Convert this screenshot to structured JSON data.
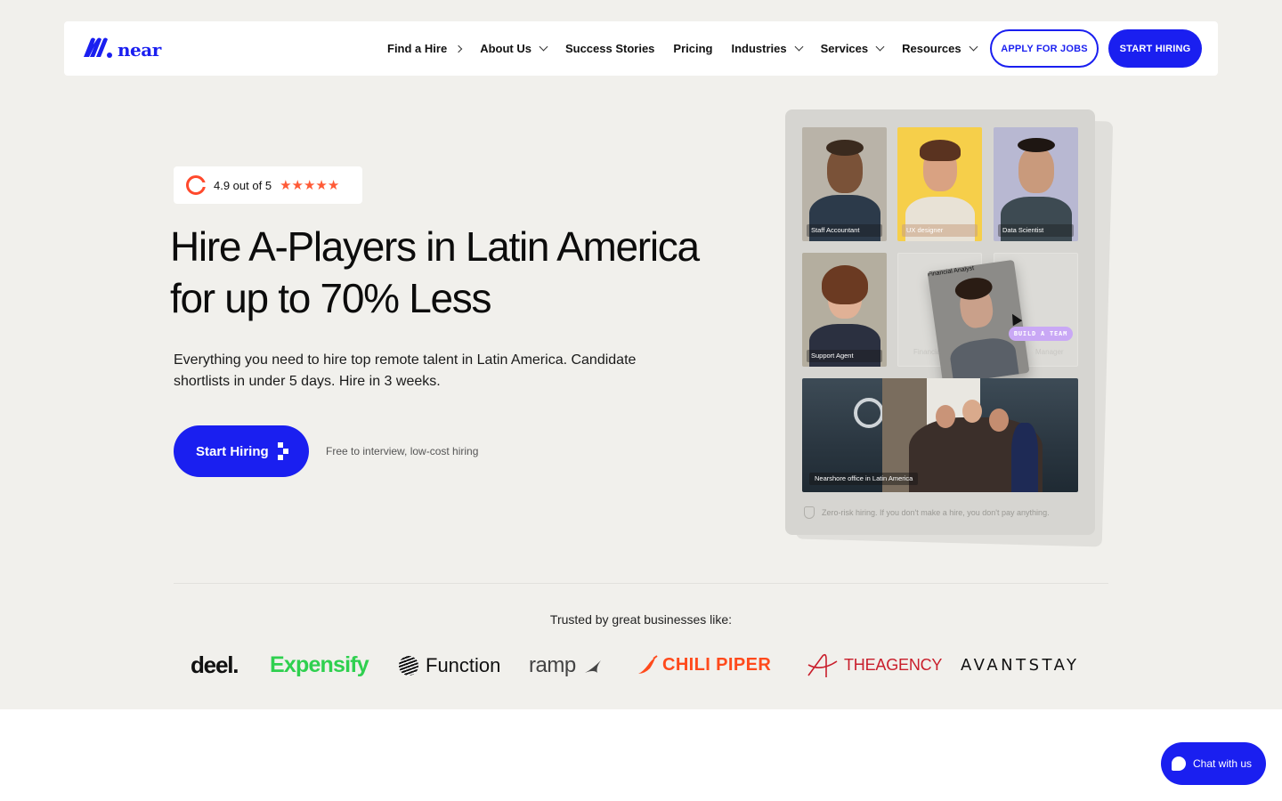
{
  "brand": {
    "name": "near",
    "accent": "#1a1ff0"
  },
  "nav": {
    "items": [
      {
        "label": "Find a Hire",
        "chevron": "right"
      },
      {
        "label": "About Us",
        "chevron": "down"
      },
      {
        "label": "Success Stories",
        "chevron": ""
      },
      {
        "label": "Pricing",
        "chevron": ""
      },
      {
        "label": "Industries",
        "chevron": "down"
      },
      {
        "label": "Services",
        "chevron": "down"
      },
      {
        "label": "Resources",
        "chevron": "down"
      }
    ],
    "apply_label": "APPLY FOR JOBS",
    "start_label": "START HIRING"
  },
  "rating": {
    "text": "4.9 out of 5",
    "stars": "★★★★★",
    "logo": "g2-icon"
  },
  "hero": {
    "headline_line1": "Hire A-Players in Latin America",
    "headline_line2": "for up to 70% Less",
    "subtext": "Everything you need to hire top remote talent in Latin America. Candidate shortlists in under 5 days. Hire in 3 weeks.",
    "cta_label": "Start Hiring",
    "cta_note": "Free to interview, low-cost hiring"
  },
  "collage": {
    "tiles": [
      "Staff Accountant",
      "UX designer",
      "Data Scientist",
      "Support Agent"
    ],
    "ghost_left": "Financia",
    "ghost_right": "Manager",
    "floating_label": "Financial Analyst",
    "build_team": "BUILD A TEAM",
    "office_caption": "Nearshore office in Latin America",
    "zero_risk": "Zero-risk hiring. If you don't make a hire, you don't pay anything."
  },
  "trusted": {
    "heading": "Trusted by great businesses like:",
    "logos": [
      "deel.",
      "Expensify",
      "Function",
      "ramp",
      "CHILI PIPER",
      "THEAGENCY",
      "AVANTSTAY"
    ]
  },
  "chat": {
    "label": "Chat with us"
  }
}
